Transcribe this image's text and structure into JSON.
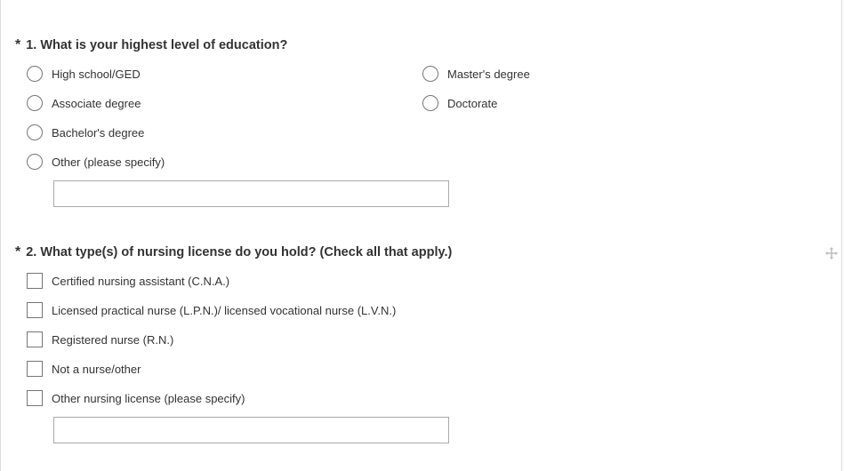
{
  "questions": [
    {
      "required_marker": "*",
      "title": "1. What is your highest level of education?",
      "type": "radio",
      "options": [
        {
          "label": "High school/GED"
        },
        {
          "label": "Associate degree"
        },
        {
          "label": "Bachelor's degree"
        },
        {
          "label": "Other (please specify)"
        },
        {
          "label": "Master's degree"
        },
        {
          "label": "Doctorate"
        }
      ],
      "other_input_value": ""
    },
    {
      "required_marker": "*",
      "title": "2. What type(s) of nursing license do you hold? (Check all that apply.)",
      "type": "checkbox",
      "options": [
        {
          "label": "Certified nursing assistant (C.N.A.)"
        },
        {
          "label": "Licensed practical nurse (L.P.N.)/ licensed vocational nurse (L.V.N.)"
        },
        {
          "label": "Registered nurse (R.N.)"
        },
        {
          "label": "Not a nurse/other"
        },
        {
          "label": "Other nursing license (please specify)"
        }
      ],
      "other_input_value": ""
    }
  ],
  "icons": {
    "move_handle": "move-icon"
  }
}
